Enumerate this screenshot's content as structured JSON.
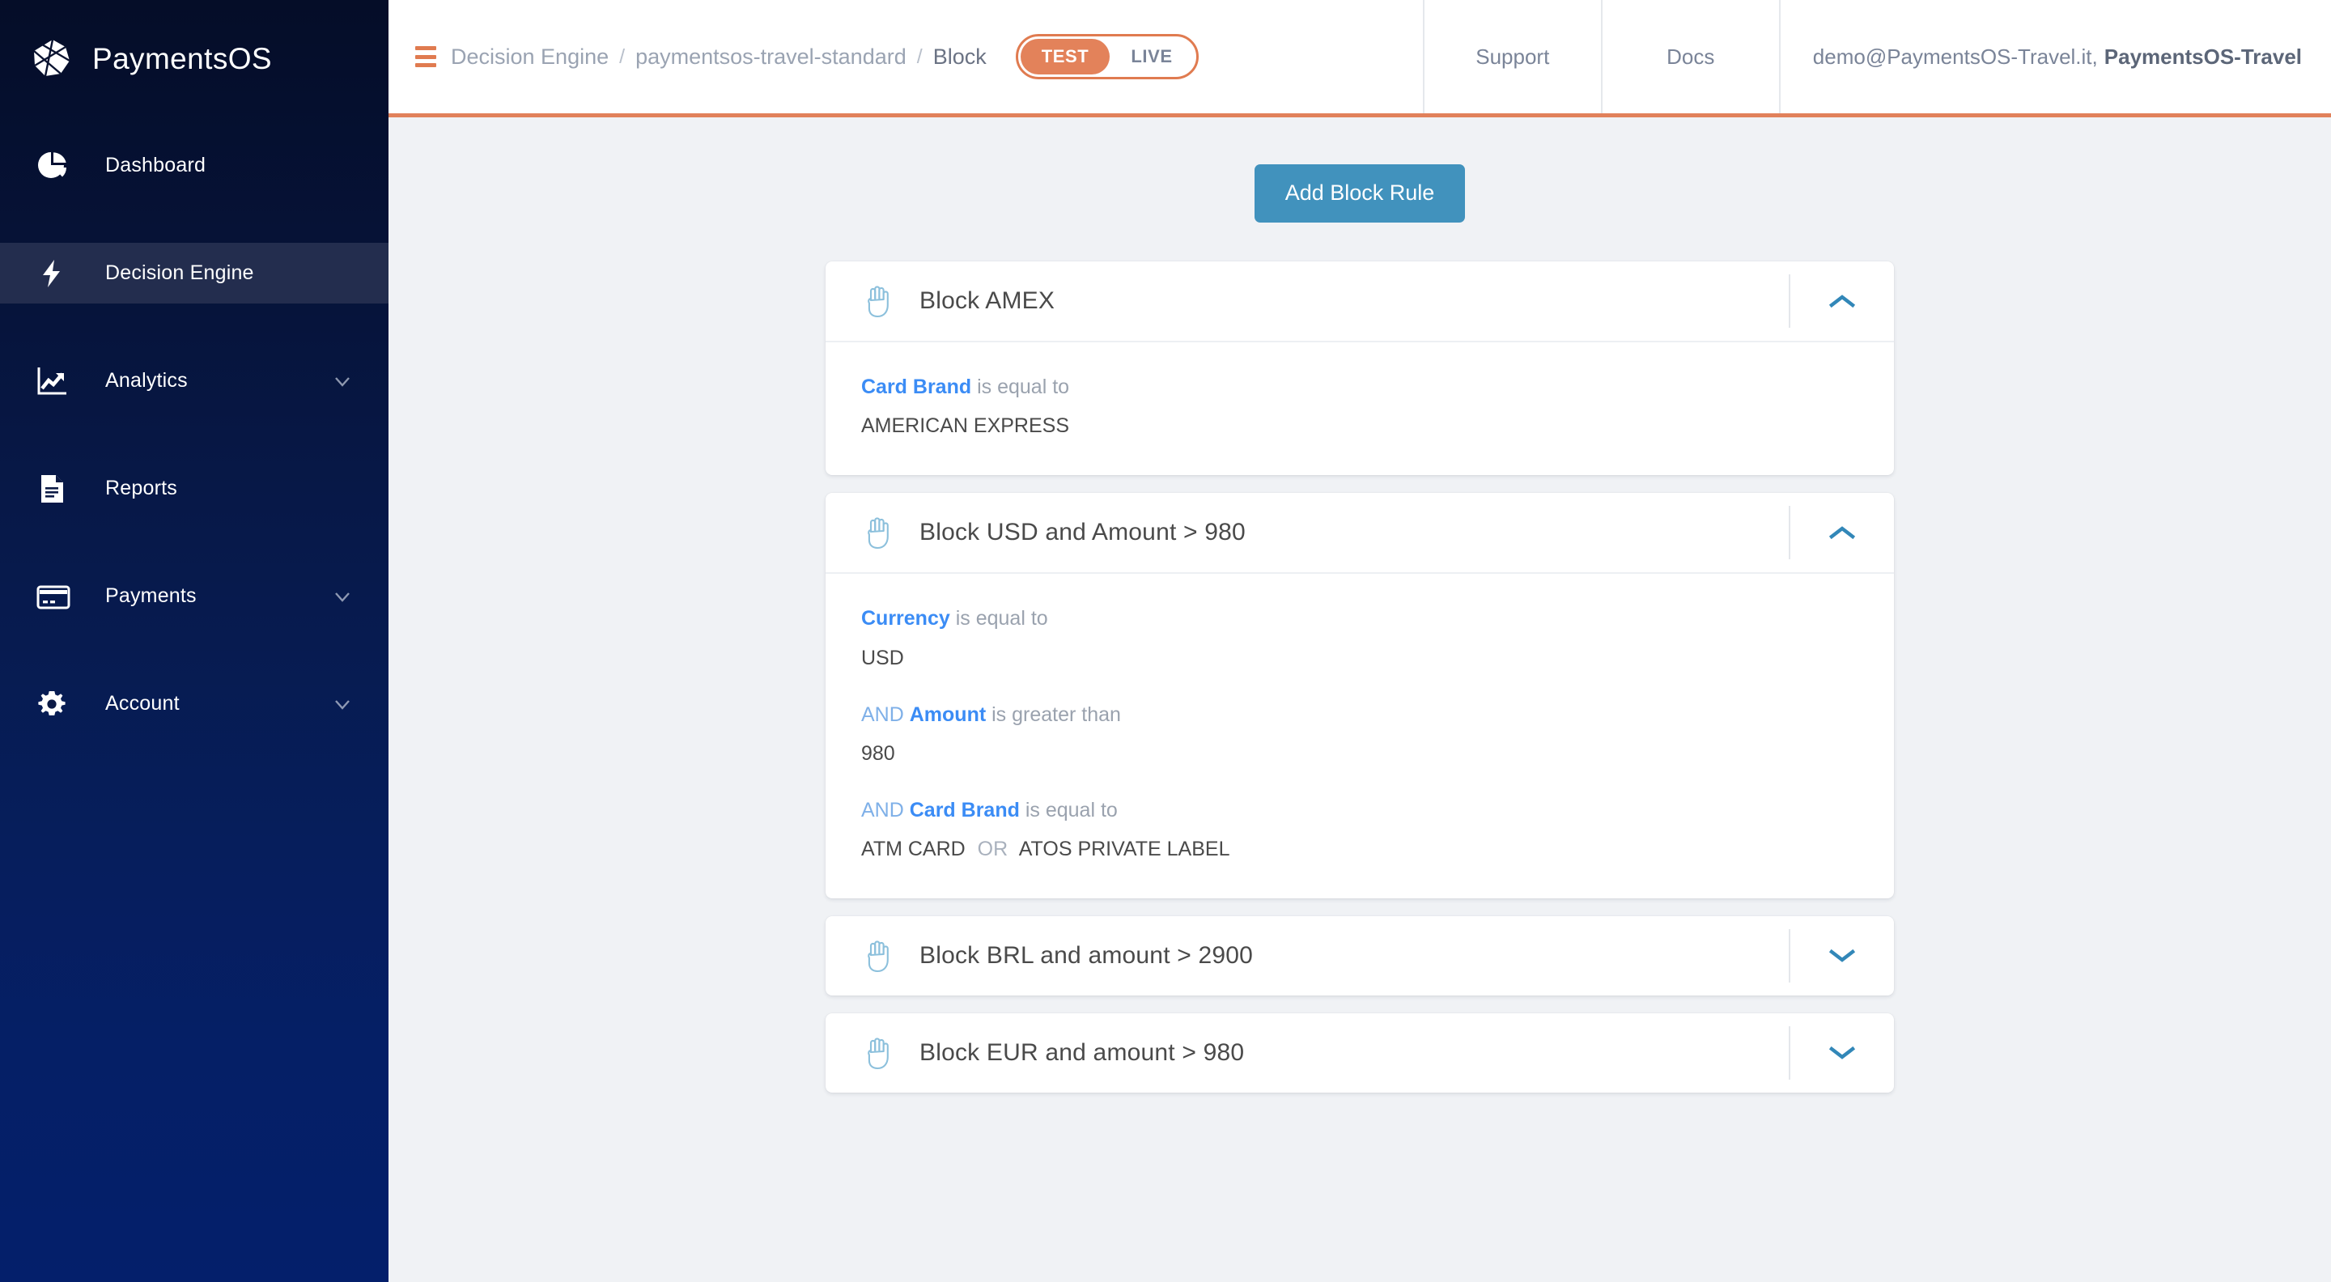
{
  "brand": {
    "name": "PaymentsOS",
    "logo_icon": "paymentsos-polygon-logo",
    "sidebar_gradient_top": "#050d28",
    "sidebar_gradient_bottom": "#041f6b"
  },
  "sidebar": {
    "items": [
      {
        "id": "dashboard",
        "label": "Dashboard",
        "icon": "pie-chart-icon",
        "active": false,
        "has_chevron": false
      },
      {
        "id": "decision-engine",
        "label": "Decision Engine",
        "icon": "lightning-bolt-icon",
        "active": true,
        "has_chevron": false
      },
      {
        "id": "analytics",
        "label": "Analytics",
        "icon": "line-chart-icon",
        "active": false,
        "has_chevron": true
      },
      {
        "id": "reports",
        "label": "Reports",
        "icon": "document-icon",
        "active": false,
        "has_chevron": false
      },
      {
        "id": "payments",
        "label": "Payments",
        "icon": "credit-card-icon",
        "active": false,
        "has_chevron": true
      },
      {
        "id": "account",
        "label": "Account",
        "icon": "gear-icon",
        "active": false,
        "has_chevron": true
      }
    ]
  },
  "topbar": {
    "menu_icon": "hamburger-menu-icon",
    "breadcrumb": [
      {
        "label": "Decision Engine",
        "current": false
      },
      {
        "label": "paymentsos-travel-standard",
        "current": false
      },
      {
        "label": "Block",
        "current": true
      }
    ],
    "breadcrumb_separator": "/",
    "env_toggle": {
      "test_label": "TEST",
      "live_label": "LIVE",
      "selected": "TEST",
      "accent_color": "#e3825a"
    },
    "support_label": "Support",
    "docs_label": "Docs",
    "user_email": "demo@PaymentsOS-Travel.it,",
    "user_org": "PaymentsOS-Travel",
    "accent_border_color": "#e1815b"
  },
  "content": {
    "add_rule_button": {
      "label": "Add Block Rule",
      "color": "#4192bd"
    },
    "rules": [
      {
        "id": "block-amex",
        "title": "Block AMEX",
        "icon": "open-hand-block-icon",
        "expanded": true,
        "chevron": "chevron-up-icon",
        "conditions": [
          {
            "connector": "",
            "field": "Card Brand",
            "operator": "is equal to",
            "values": [
              "AMERICAN EXPRESS"
            ],
            "value_separator": ""
          }
        ]
      },
      {
        "id": "block-usd-amount-980",
        "title": "Block USD and Amount > 980",
        "icon": "open-hand-block-icon",
        "expanded": true,
        "chevron": "chevron-up-icon",
        "conditions": [
          {
            "connector": "",
            "field": "Currency",
            "operator": "is equal to",
            "values": [
              "USD"
            ],
            "value_separator": ""
          },
          {
            "connector": "AND",
            "field": "Amount",
            "operator": "is greater than",
            "values": [
              "980"
            ],
            "value_separator": ""
          },
          {
            "connector": "AND",
            "field": "Card Brand",
            "operator": "is equal to",
            "values": [
              "ATM CARD",
              "ATOS PRIVATE LABEL"
            ],
            "value_separator": "OR"
          }
        ]
      },
      {
        "id": "block-brl-amount-2900",
        "title": "Block BRL and amount > 2900",
        "icon": "open-hand-block-icon",
        "expanded": false,
        "chevron": "chevron-down-icon",
        "conditions": []
      },
      {
        "id": "block-eur-amount-980",
        "title": "Block EUR and amount > 980",
        "icon": "open-hand-block-icon",
        "expanded": false,
        "chevron": "chevron-down-icon",
        "conditions": []
      }
    ]
  }
}
